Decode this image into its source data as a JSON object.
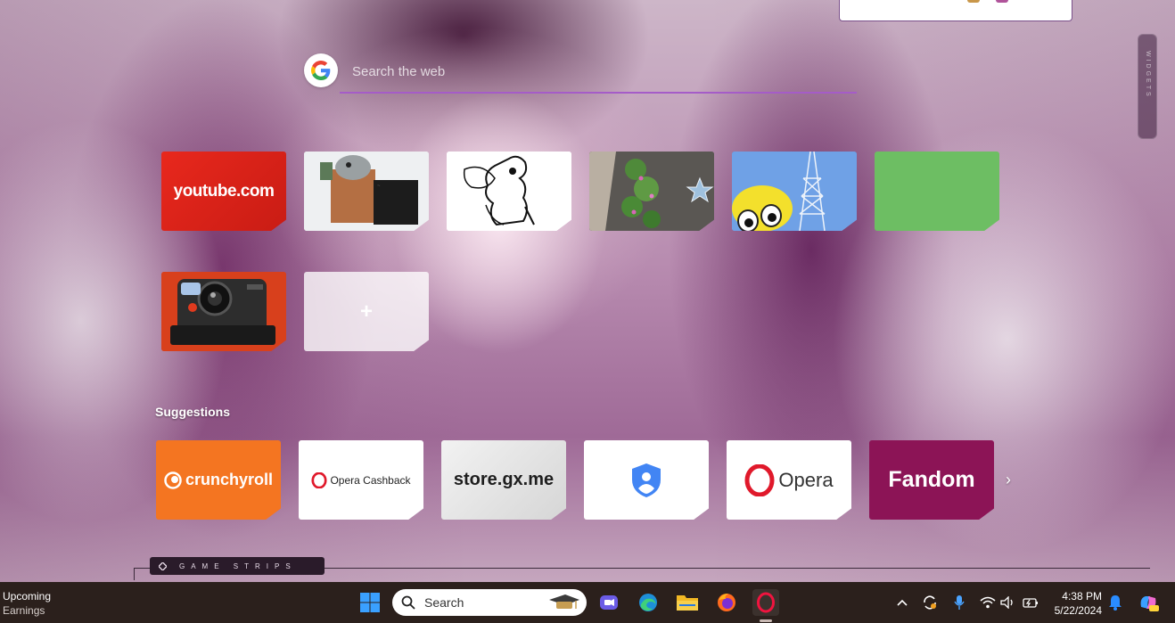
{
  "search": {
    "placeholder": "Search the web",
    "engine_icon": "google-g-icon"
  },
  "side_rail": {
    "label": "WIDGETS"
  },
  "speed_dials": [
    {
      "name": "youtube",
      "label": "youtube.com"
    },
    {
      "name": "roblox-thumb",
      "label": ""
    },
    {
      "name": "sketch-thumb",
      "label": ""
    },
    {
      "name": "garden-thumb",
      "label": ""
    },
    {
      "name": "tower-thumb",
      "label": ""
    },
    {
      "name": "green-thumb",
      "label": ""
    },
    {
      "name": "camera-thumb",
      "label": ""
    },
    {
      "name": "add-site",
      "label": "+"
    }
  ],
  "suggestions": {
    "heading": "Suggestions",
    "items": [
      {
        "name": "crunchyroll",
        "label": "crunchyroll"
      },
      {
        "name": "opera-cashback",
        "label": "Opera Cashback"
      },
      {
        "name": "store-gx",
        "label": "store.gx.me"
      },
      {
        "name": "security-shield",
        "label": ""
      },
      {
        "name": "opera",
        "label": "Opera"
      },
      {
        "name": "fandom",
        "label": "Fandom"
      }
    ],
    "next_arrow": "›"
  },
  "game_strips": {
    "label": "GAME STRIPS"
  },
  "taskbar": {
    "widget_title": "Upcoming",
    "widget_subtitle": "Earnings",
    "search_label": "Search",
    "time": "4:38 PM",
    "date": "5/22/2024"
  },
  "colors": {
    "accent_purple": "#a55cc8",
    "youtube_red": "#e8281d",
    "crunchyroll_orange": "#f47521",
    "fandom_magenta": "#8c1456",
    "taskbar_bg": "#2b201c"
  }
}
